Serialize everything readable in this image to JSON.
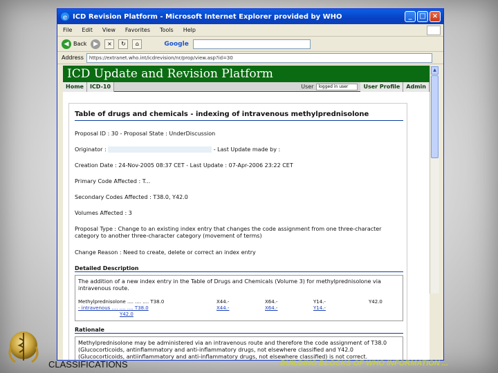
{
  "window": {
    "title": "ICD Revision Platform - Microsoft Internet Explorer provided by WHO"
  },
  "menu": [
    "File",
    "Edit",
    "View",
    "Favorites",
    "Tools",
    "Help"
  ],
  "toolbar": {
    "back_label": "Back",
    "google_label": "Google"
  },
  "address": {
    "label": "Address",
    "url": "https://extranet.who.int/icdrevision/nr/prop/view.asp?id=30"
  },
  "site": {
    "banner_title": "ICD Update and Revision Platform",
    "nav": [
      "Home",
      "ICD-10"
    ],
    "user_label": "User",
    "user_value": "logged in user",
    "nav_right": [
      "User Profile",
      "Admin"
    ]
  },
  "proposal": {
    "title": "Table of drugs and chemicals - indexing of intravenous methylprednisolone",
    "line1": "Proposal ID : 30  -  Proposal State : UnderDiscussion",
    "originator_label": "Originator :",
    "last_update_label": "-  Last Update made by :",
    "creation": "Creation Date : 24-Nov-2005 08:37 CET  -  Last Update : 07-Apr-2006 23:22 CET",
    "primary": "Primary Code Affected : T...",
    "secondary": "Secondary Codes Affected : T38.0, Y42.0",
    "volumes": "Volumes Affected : 3",
    "type": "Proposal Type : Change to an existing index entry that changes the code assignment from one three-character category to another three-character category (movement of terms)",
    "reason": "Change Reason : Need to create, delete or correct an index entry",
    "detailed_h": "Detailed Description",
    "detailed_p": "The addition of a new index entry in the Table of Drugs and Chemicals (Volume 3) for methylprednisolone via intravenous route.",
    "idx_row1": [
      "Methylprednisolone  ....  ....  ....  T38.0",
      "X44.-",
      "X64.-",
      "Y14.-",
      "Y42.0"
    ],
    "idx_row2": [
      "- intravenous  ....  ....  ....  T38.0",
      "X44.-",
      "X64.-",
      "Y14.-"
    ],
    "idx_row3": "Y42.0",
    "rationale_h": "Rationale",
    "rationale_p": "Methylprednisolone may be administered via an intravenous route and therefore the code assignment of T38.0 (Glucocorticoids, antinflammatory and anti-inflammatory drugs, not elsewhere classified and Y42.0 (Glucocorticoids, antiinflammatory and anti-inflammatory drugs, not elsewhere classified) is not correct."
  },
  "footer": {
    "left": "CLASSIFICATIONS",
    "right": "BUILDING BLOCKS OF WHO INFORMATION ..."
  }
}
